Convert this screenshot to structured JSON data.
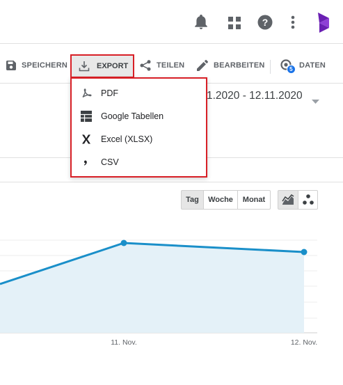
{
  "toolbar": {
    "save_label": "SPEICHERN",
    "export_label": "EXPORT",
    "share_label": "TEILEN",
    "edit_label": "BEARBEITEN",
    "data_label": "DATEN",
    "data_badge": "5"
  },
  "export_menu": {
    "items": [
      {
        "label": "PDF",
        "icon": "pdf-icon"
      },
      {
        "label": "Google Tabellen",
        "icon": "sheets-icon"
      },
      {
        "label": "Excel (XLSX)",
        "icon": "excel-icon"
      },
      {
        "label": "CSV",
        "icon": "csv-icon"
      }
    ]
  },
  "date_range": "1.2020 - 12.11.2020",
  "granularity": {
    "options": [
      "Tag",
      "Woche",
      "Monat"
    ],
    "selected": "Tag"
  },
  "colors": {
    "accent": "#1a8fc9",
    "highlight_border": "#d81f26",
    "brand": "#7b2cbf"
  },
  "chart_data": {
    "type": "area",
    "x": [
      "",
      "11. Nov.",
      "12. Nov."
    ],
    "x_tick_labels": [
      "11. Nov.",
      "12. Nov."
    ],
    "series": [
      {
        "values": [
          null,
          null,
          null
        ]
      }
    ],
    "grid": true,
    "title": "",
    "xlabel": "",
    "ylabel": ""
  }
}
